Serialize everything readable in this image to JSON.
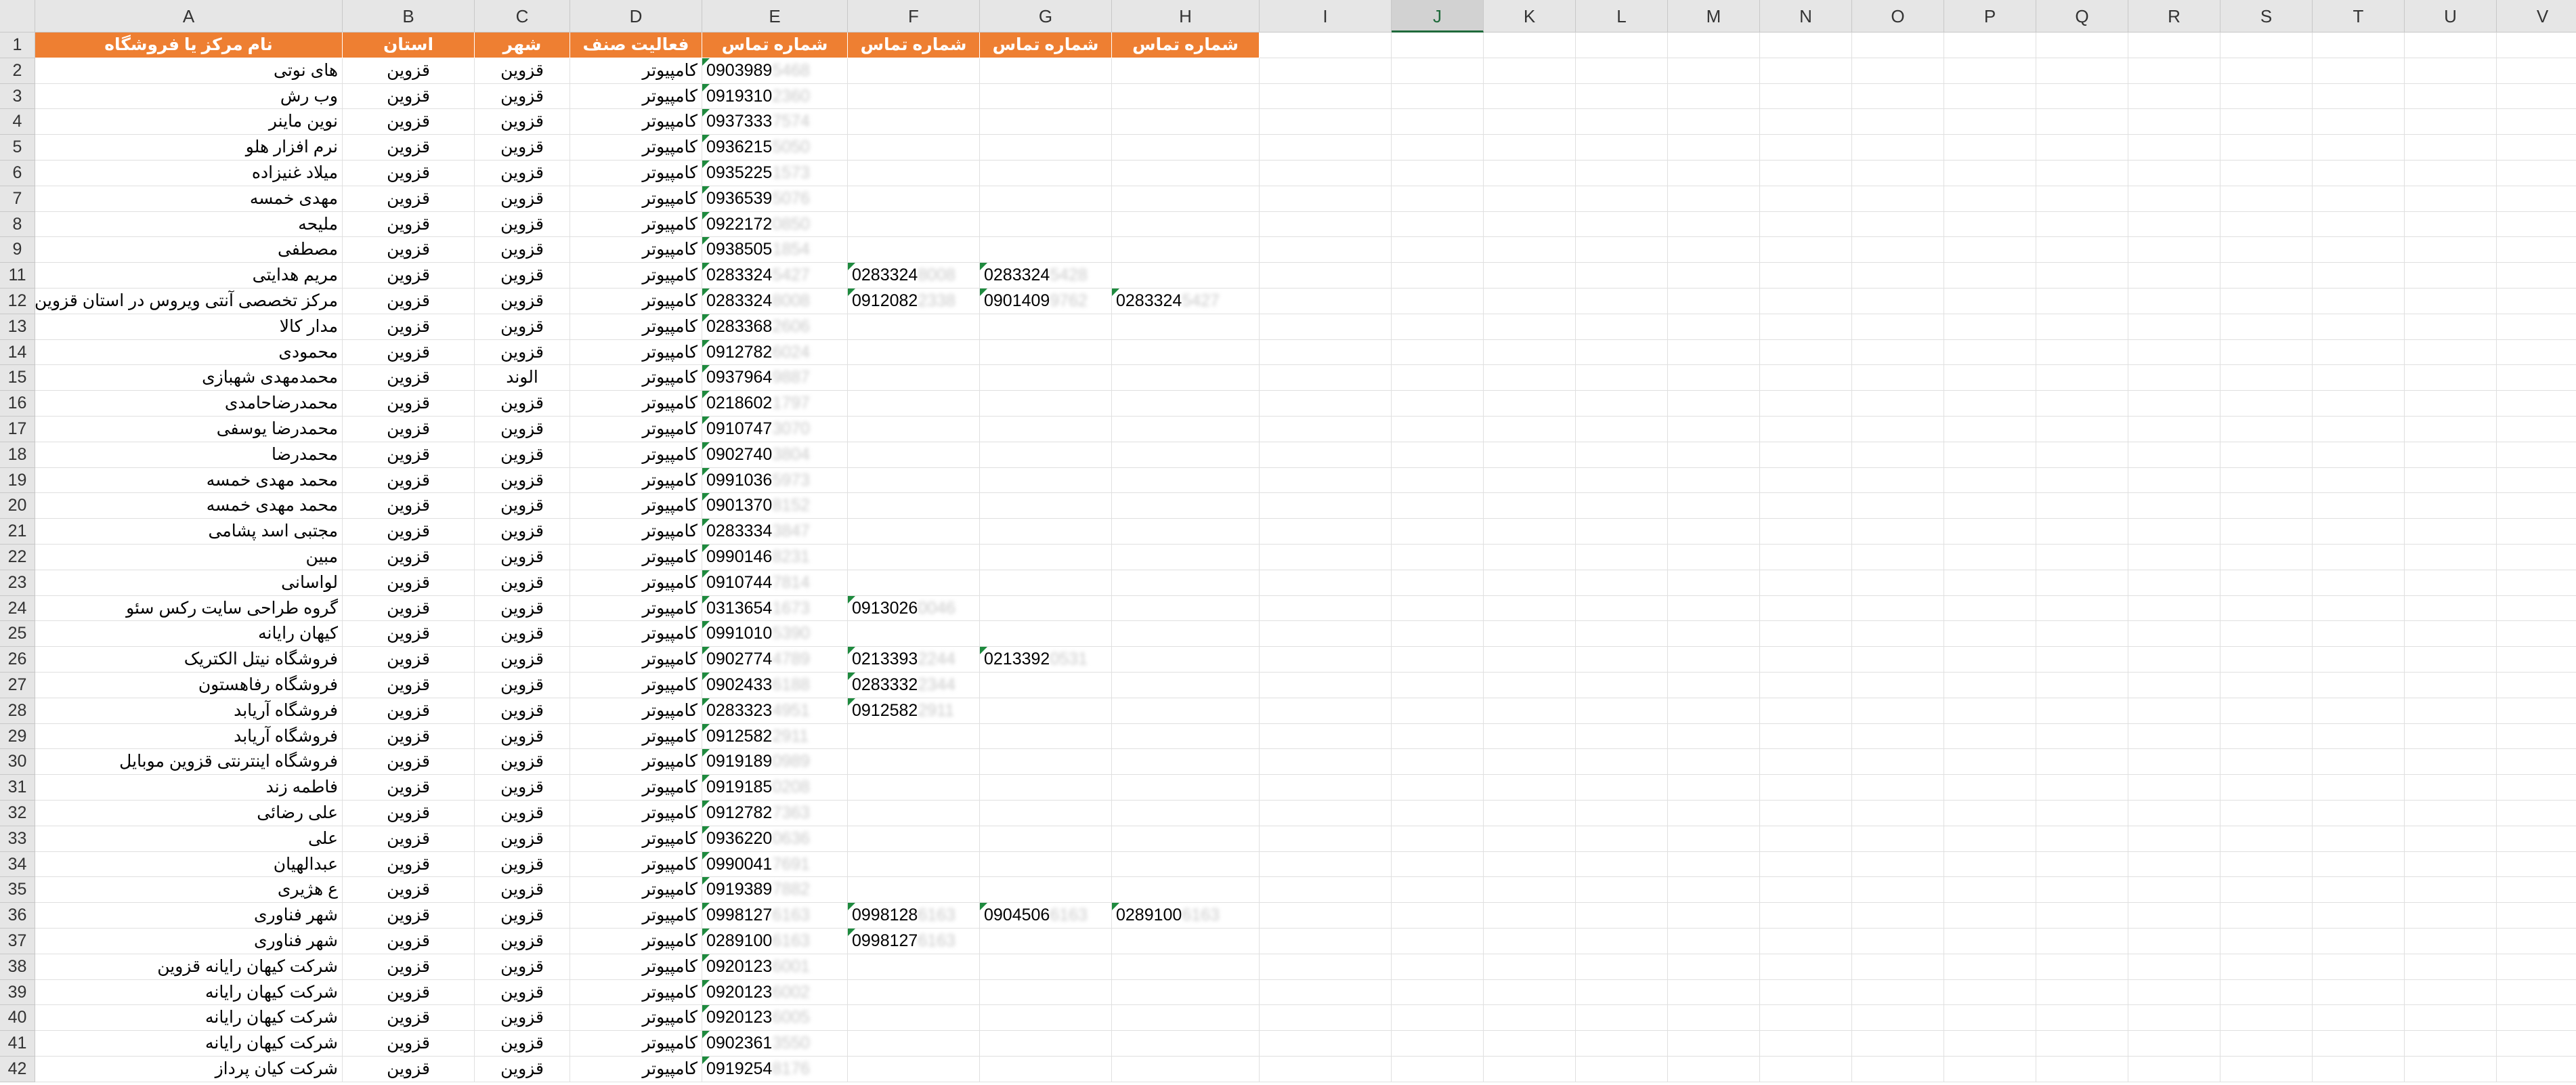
{
  "columns": [
    "A",
    "B",
    "C",
    "D",
    "E",
    "F",
    "G",
    "H",
    "I",
    "J",
    "K",
    "L",
    "M",
    "N",
    "O",
    "P",
    "Q",
    "R",
    "S",
    "T",
    "U",
    "V"
  ],
  "selected_column": "J",
  "header_row": [
    "نام مرکز یا فروشگاه",
    "استان",
    "شهر",
    "فعالیت صنف",
    "شماره تماس",
    "شماره تماس",
    "شماره تماس",
    "شماره تماس"
  ],
  "rows": [
    {
      "n": "2",
      "name": "های نوتی",
      "province": "قزوین",
      "city": "قزوین",
      "activity": "کامپیوتر",
      "phones": [
        [
          "0903989",
          "5468"
        ]
      ]
    },
    {
      "n": "3",
      "name": "وب رش",
      "province": "قزوین",
      "city": "قزوین",
      "activity": "کامپیوتر",
      "phones": [
        [
          "0919310",
          "2360"
        ]
      ]
    },
    {
      "n": "4",
      "name": "نوین ماینر",
      "province": "قزوین",
      "city": "قزوین",
      "activity": "کامپیوتر",
      "phones": [
        [
          "0937333",
          "7574"
        ]
      ]
    },
    {
      "n": "5",
      "name": "نرم افزار هلو",
      "province": "قزوین",
      "city": "قزوین",
      "activity": "کامپیوتر",
      "phones": [
        [
          "0936215",
          "5050"
        ]
      ]
    },
    {
      "n": "6",
      "name": "میلاد غنیزاده",
      "province": "قزوین",
      "city": "قزوین",
      "activity": "کامپیوتر",
      "phones": [
        [
          "0935225",
          "1573"
        ]
      ]
    },
    {
      "n": "7",
      "name": "مهدی خمسه",
      "province": "قزوین",
      "city": "قزوین",
      "activity": "کامپیوتر",
      "phones": [
        [
          "0936539",
          "5076"
        ]
      ]
    },
    {
      "n": "8",
      "name": "ملیحه",
      "province": "قزوین",
      "city": "قزوین",
      "activity": "کامپیوتر",
      "phones": [
        [
          "0922172",
          "0850"
        ]
      ]
    },
    {
      "n": "9",
      "name": "مصطفی",
      "province": "قزوین",
      "city": "قزوین",
      "activity": "کامپیوتر",
      "phones": [
        [
          "0938505",
          "1854"
        ]
      ]
    },
    {
      "n": "11",
      "name": "مریم هدایتی",
      "province": "قزوین",
      "city": "قزوین",
      "activity": "کامپیوتر",
      "phones": [
        [
          "0283324",
          "5427"
        ],
        [
          "0283324",
          "8008"
        ],
        [
          "0283324",
          "5428"
        ]
      ]
    },
    {
      "n": "12",
      "name": "مرکز تخصصی آنتی ویروس در استان قزوین",
      "province": "قزوین",
      "city": "قزوین",
      "activity": "کامپیوتر",
      "phones": [
        [
          "0283324",
          "8008"
        ],
        [
          "0912082",
          "2338"
        ],
        [
          "0901409",
          "9762"
        ],
        [
          "0283324",
          "5427"
        ]
      ]
    },
    {
      "n": "13",
      "name": "مدار کالا",
      "province": "قزوین",
      "city": "قزوین",
      "activity": "کامپیوتر",
      "phones": [
        [
          "0283368",
          "2606"
        ]
      ]
    },
    {
      "n": "14",
      "name": "محمودی",
      "province": "قزوین",
      "city": "قزوین",
      "activity": "کامپیوتر",
      "phones": [
        [
          "0912782",
          "6024"
        ]
      ]
    },
    {
      "n": "15",
      "name": "محمدمهدی شهبازی",
      "province": "قزوین",
      "city": "الوند",
      "activity": "کامپیوتر",
      "phones": [
        [
          "0937964",
          "9887"
        ]
      ]
    },
    {
      "n": "16",
      "name": "محمدرضاحامدی",
      "province": "قزوین",
      "city": "قزوین",
      "activity": "کامپیوتر",
      "phones": [
        [
          "0218602",
          "1797"
        ]
      ]
    },
    {
      "n": "17",
      "name": "محمدرضا یوسفی",
      "province": "قزوین",
      "city": "قزوین",
      "activity": "کامپیوتر",
      "phones": [
        [
          "0910747",
          "3070"
        ]
      ]
    },
    {
      "n": "18",
      "name": "محمدرضا",
      "province": "قزوین",
      "city": "قزوین",
      "activity": "کامپیوتر",
      "phones": [
        [
          "0902740",
          "3804"
        ]
      ]
    },
    {
      "n": "19",
      "name": "محمد مهدی خمسه",
      "province": "قزوین",
      "city": "قزوین",
      "activity": "کامپیوتر",
      "phones": [
        [
          "0991036",
          "5973"
        ]
      ]
    },
    {
      "n": "20",
      "name": "محمد مهدی خمسه",
      "province": "قزوین",
      "city": "قزوین",
      "activity": "کامپیوتر",
      "phones": [
        [
          "0901370",
          "8152"
        ]
      ]
    },
    {
      "n": "21",
      "name": "مجتبی اسد پشامی",
      "province": "قزوین",
      "city": "قزوین",
      "activity": "کامپیوتر",
      "phones": [
        [
          "0283334",
          "3847"
        ]
      ]
    },
    {
      "n": "22",
      "name": "مبین",
      "province": "قزوین",
      "city": "قزوین",
      "activity": "کامپیوتر",
      "phones": [
        [
          "0990146",
          "8231"
        ]
      ]
    },
    {
      "n": "23",
      "name": "لواسانی",
      "province": "قزوین",
      "city": "قزوین",
      "activity": "کامپیوتر",
      "phones": [
        [
          "0910744",
          "7814"
        ]
      ]
    },
    {
      "n": "24",
      "name": "گروه طراحی سایت رکس سئو",
      "province": "قزوین",
      "city": "قزوین",
      "activity": "کامپیوتر",
      "phones": [
        [
          "0313654",
          "1673"
        ],
        [
          "0913026",
          "0046"
        ]
      ]
    },
    {
      "n": "25",
      "name": "کیهان رایانه",
      "province": "قزوین",
      "city": "قزوین",
      "activity": "کامپیوتر",
      "phones": [
        [
          "0991010",
          "5390"
        ]
      ]
    },
    {
      "n": "26",
      "name": "فروشگاه نیتل الکتریک",
      "province": "قزوین",
      "city": "قزوین",
      "activity": "کامپیوتر",
      "phones": [
        [
          "0902774",
          "4789"
        ],
        [
          "0213393",
          "2244"
        ],
        [
          "0213392",
          "0531"
        ]
      ]
    },
    {
      "n": "27",
      "name": "فروشگاه رفاهستون",
      "province": "قزوین",
      "city": "قزوین",
      "activity": "کامپیوتر",
      "phones": [
        [
          "0902433",
          "6188"
        ],
        [
          "0283332",
          "2344"
        ]
      ]
    },
    {
      "n": "28",
      "name": "فروشگاه آریابد",
      "province": "قزوین",
      "city": "قزوین",
      "activity": "کامپیوتر",
      "phones": [
        [
          "0283323",
          "4951"
        ],
        [
          "0912582",
          "2911"
        ]
      ]
    },
    {
      "n": "29",
      "name": "فروشگاه آریابد",
      "province": "قزوین",
      "city": "قزوین",
      "activity": "کامپیوتر",
      "phones": [
        [
          "0912582",
          "2911"
        ]
      ]
    },
    {
      "n": "30",
      "name": "فروشگاه اینترنتی قزوین موبایل",
      "province": "قزوین",
      "city": "قزوین",
      "activity": "کامپیوتر",
      "phones": [
        [
          "0919189",
          "0989"
        ]
      ]
    },
    {
      "n": "31",
      "name": "فاطمه زند",
      "province": "قزوین",
      "city": "قزوین",
      "activity": "کامپیوتر",
      "phones": [
        [
          "0919185",
          "0208"
        ]
      ]
    },
    {
      "n": "32",
      "name": "علی رضائی",
      "province": "قزوین",
      "city": "قزوین",
      "activity": "کامپیوتر",
      "phones": [
        [
          "0912782",
          "7363"
        ]
      ]
    },
    {
      "n": "33",
      "name": "علی",
      "province": "قزوین",
      "city": "قزوین",
      "activity": "کامپیوتر",
      "phones": [
        [
          "0936220",
          "0636"
        ]
      ]
    },
    {
      "n": "34",
      "name": "عبدالهیان",
      "province": "قزوین",
      "city": "قزوین",
      "activity": "کامپیوتر",
      "phones": [
        [
          "0990041",
          "7691"
        ]
      ]
    },
    {
      "n": "35",
      "name": "ع هژیری",
      "province": "قزوین",
      "city": "قزوین",
      "activity": "کامپیوتر",
      "phones": [
        [
          "0919389",
          "7882"
        ]
      ]
    },
    {
      "n": "36",
      "name": "شهر فناوری",
      "province": "قزوین",
      "city": "قزوین",
      "activity": "کامپیوتر",
      "phones": [
        [
          "0998127",
          "6163"
        ],
        [
          "0998128",
          "6163"
        ],
        [
          "0904506",
          "6163"
        ],
        [
          "0289100",
          "6163"
        ]
      ]
    },
    {
      "n": "37",
      "name": "شهر فناوری",
      "province": "قزوین",
      "city": "قزوین",
      "activity": "کامپیوتر",
      "phones": [
        [
          "0289100",
          "6163"
        ],
        [
          "0998127",
          "6163"
        ]
      ]
    },
    {
      "n": "38",
      "name": "شرکت کیهان رایانه قزوین",
      "province": "قزوین",
      "city": "قزوین",
      "activity": "کامپیوتر",
      "phones": [
        [
          "0920123",
          "6001"
        ]
      ]
    },
    {
      "n": "39",
      "name": "شرکت کیهان رایانه",
      "province": "قزوین",
      "city": "قزوین",
      "activity": "کامپیوتر",
      "phones": [
        [
          "0920123",
          "6002"
        ]
      ]
    },
    {
      "n": "40",
      "name": "شرکت کیهان رایانه",
      "province": "قزوین",
      "city": "قزوین",
      "activity": "کامپیوتر",
      "phones": [
        [
          "0920123",
          "6005"
        ]
      ]
    },
    {
      "n": "41",
      "name": "شرکت کیهان رایانه",
      "province": "قزوین",
      "city": "قزوین",
      "activity": "کامپیوتر",
      "phones": [
        [
          "0902361",
          "3550"
        ]
      ]
    },
    {
      "n": "42",
      "name": "شرکت کیان پرداز",
      "province": "قزوین",
      "city": "قزوین",
      "activity": "کامپیوتر",
      "phones": [
        [
          "0919254",
          "8176"
        ]
      ]
    }
  ]
}
